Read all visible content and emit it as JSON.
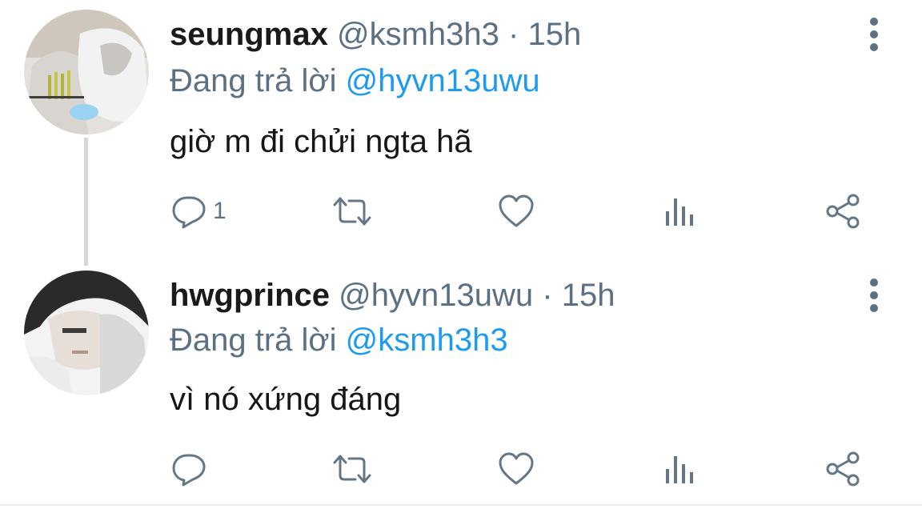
{
  "tweets": [
    {
      "display_name": "seungmax",
      "handle": "@ksmh3h3",
      "separator": "·",
      "time": "15h",
      "reply_prefix": "Đang trả lời",
      "reply_to": "@hyvn13uwu",
      "text": "giờ m đi chửi ngta hã",
      "reply_count": "1"
    },
    {
      "display_name": "hwgprince",
      "handle": "@hyvn13uwu",
      "separator": "·",
      "time": "15h",
      "reply_prefix": "Đang trả lời",
      "reply_to": "@ksmh3h3",
      "text": "vì nó xứng đáng",
      "reply_count": ""
    }
  ],
  "icons": {
    "more": "more-vertical-icon",
    "reply": "reply-icon",
    "retweet": "retweet-icon",
    "like": "heart-icon",
    "views": "analytics-icon",
    "share": "share-icon"
  },
  "colors": {
    "accent": "#1d9bf0",
    "secondary_text": "#5b7083",
    "icon": "#657786",
    "thread_line": "#cfd9de"
  }
}
